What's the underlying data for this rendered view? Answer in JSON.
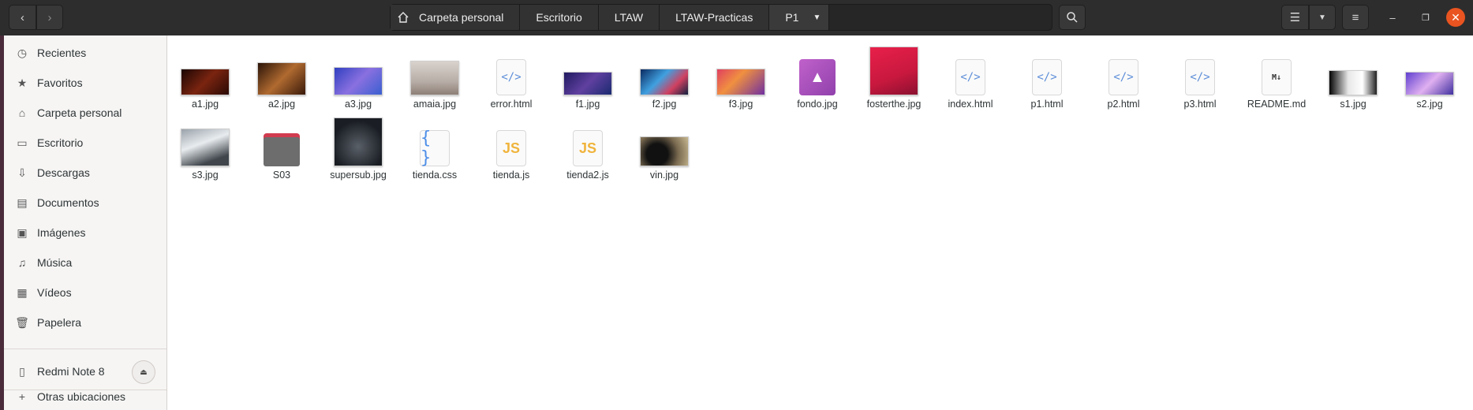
{
  "nav": {
    "back_icon": "‹",
    "forward_icon": "›"
  },
  "pathbar": {
    "crumbs": [
      "Carpeta personal",
      "Escritorio",
      "LTAW",
      "LTAW-Practicas",
      "P1"
    ],
    "dropdown_icon": "▼"
  },
  "toolbar": {
    "search_icon": "⌕",
    "list_view_icon": "☰",
    "view_options_icon": "▼",
    "menu_icon": "≡",
    "minimize_icon": "–",
    "maximize_icon": "❐",
    "close_icon": "✕"
  },
  "sidebar": {
    "items": [
      {
        "label": "Recientes",
        "icon": "◷"
      },
      {
        "label": "Favoritos",
        "icon": "★"
      },
      {
        "label": "Carpeta personal",
        "icon": "⌂"
      },
      {
        "label": "Escritorio",
        "icon": "▭"
      },
      {
        "label": "Descargas",
        "icon": "⇩"
      },
      {
        "label": "Documentos",
        "icon": "▤"
      },
      {
        "label": "Imágenes",
        "icon": "▣"
      },
      {
        "label": "Música",
        "icon": "♫"
      },
      {
        "label": "Vídeos",
        "icon": "▦"
      },
      {
        "label": "Papelera",
        "icon": "🗑"
      }
    ],
    "device": {
      "label": "Redmi Note 8",
      "icon": "▯",
      "eject_icon": "⏏"
    },
    "other": {
      "label": "Otras ubicaciones",
      "icon": "+"
    }
  },
  "files": [
    {
      "name": "a1.jpg",
      "kind": "image"
    },
    {
      "name": "a2.jpg",
      "kind": "image"
    },
    {
      "name": "a3.jpg",
      "kind": "image"
    },
    {
      "name": "amaia.jpg",
      "kind": "image"
    },
    {
      "name": "error.html",
      "kind": "html",
      "glyph": "</>"
    },
    {
      "name": "f1.jpg",
      "kind": "image"
    },
    {
      "name": "f2.jpg",
      "kind": "image"
    },
    {
      "name": "f3.jpg",
      "kind": "image"
    },
    {
      "name": "fondo.jpg",
      "kind": "image-icon"
    },
    {
      "name": "fosterthe.jpg",
      "kind": "image"
    },
    {
      "name": "index.html",
      "kind": "html",
      "glyph": "</>"
    },
    {
      "name": "p1.html",
      "kind": "html",
      "glyph": "</>"
    },
    {
      "name": "p2.html",
      "kind": "html",
      "glyph": "</>"
    },
    {
      "name": "p3.html",
      "kind": "html",
      "glyph": "</>"
    },
    {
      "name": "README.md",
      "kind": "markdown",
      "glyph": "M↓"
    },
    {
      "name": "s1.jpg",
      "kind": "image"
    },
    {
      "name": "s2.jpg",
      "kind": "image"
    },
    {
      "name": "s3.jpg",
      "kind": "image"
    },
    {
      "name": "S03",
      "kind": "folder"
    },
    {
      "name": "supersub.jpg",
      "kind": "image"
    },
    {
      "name": "tienda.css",
      "kind": "css",
      "glyph": "{ }"
    },
    {
      "name": "tienda.js",
      "kind": "js",
      "glyph": "JS"
    },
    {
      "name": "tienda2.js",
      "kind": "js",
      "glyph": "JS"
    },
    {
      "name": "vin.jpg",
      "kind": "image"
    }
  ]
}
